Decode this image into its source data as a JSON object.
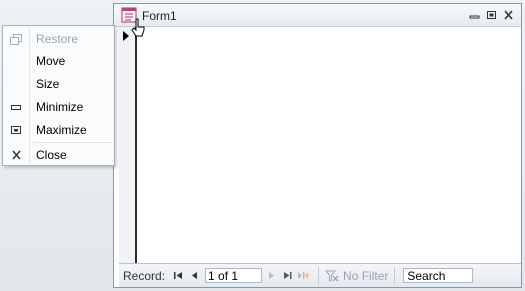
{
  "form": {
    "title": "Form1"
  },
  "system_menu": {
    "items": [
      {
        "label": "Restore",
        "enabled": false,
        "icon": "restore-icon"
      },
      {
        "label": "Move",
        "enabled": true,
        "icon": ""
      },
      {
        "label": "Size",
        "enabled": true,
        "icon": ""
      },
      {
        "label": "Minimize",
        "enabled": true,
        "icon": "minimize-icon"
      },
      {
        "label": "Maximize",
        "enabled": true,
        "icon": "maximize-icon"
      },
      {
        "label": "Close",
        "enabled": true,
        "icon": "close-icon"
      }
    ]
  },
  "navigation": {
    "record_label": "Record:",
    "record_position": "1 of 1",
    "filter_label": "No Filter",
    "search_placeholder": "Search"
  }
}
